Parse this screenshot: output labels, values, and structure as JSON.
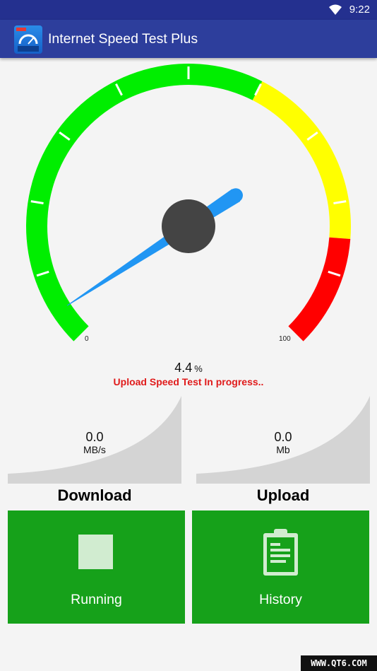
{
  "status_bar": {
    "time": "9:22",
    "wifi_icon": "wifi-icon"
  },
  "app_bar": {
    "title": "Internet Speed Test Plus",
    "icon_text": "90.2 Mbps",
    "icon_badge": "RSS"
  },
  "gauge": {
    "min_label": "0",
    "max_label": "100",
    "needle_value_percent": 4.4,
    "colors": {
      "green": "#00ee00",
      "yellow": "#ffff00",
      "red": "#ff0000",
      "needle": "#2196f3",
      "hub": "#444444"
    }
  },
  "progress": {
    "percent_value": "4.4",
    "percent_unit": "%",
    "status_text": "Upload Speed Test In progress.."
  },
  "download": {
    "value": "0.0",
    "unit": "MB/s",
    "label": "Download"
  },
  "upload": {
    "value": "0.0",
    "unit": "Mb",
    "label": "Upload"
  },
  "buttons": {
    "running": {
      "label": "Running",
      "icon": "stop-icon"
    },
    "history": {
      "label": "History",
      "icon": "clipboard-icon"
    }
  },
  "accent_colors": {
    "primary": "#2d3e9c",
    "button_green": "#16a11a",
    "status_red": "#e01b1b"
  },
  "watermark": "WWW.QT6.COM"
}
